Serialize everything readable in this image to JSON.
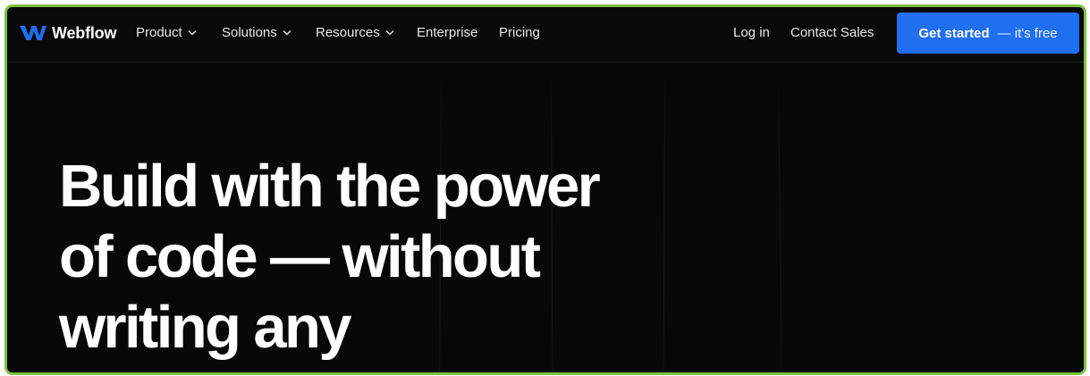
{
  "nav": {
    "logo_text": "Webflow",
    "items": [
      {
        "label": "Product",
        "has_dropdown": true
      },
      {
        "label": "Solutions",
        "has_dropdown": true
      },
      {
        "label": "Resources",
        "has_dropdown": true
      },
      {
        "label": "Enterprise",
        "has_dropdown": false
      },
      {
        "label": "Pricing",
        "has_dropdown": false
      }
    ],
    "login_label": "Log in",
    "contact_label": "Contact Sales",
    "cta": {
      "primary": "Get started",
      "secondary": "— it's free"
    }
  },
  "hero": {
    "headline_lines": [
      "Build with the power",
      "of code — without",
      "writing any"
    ]
  },
  "colors": {
    "accent": "#1f6ff0",
    "background": "#080808",
    "frame_border": "#7dc23f",
    "text": "#ffffff"
  },
  "icons": {
    "logo": "webflow-logo-icon",
    "dropdown": "chevron-down-icon"
  }
}
